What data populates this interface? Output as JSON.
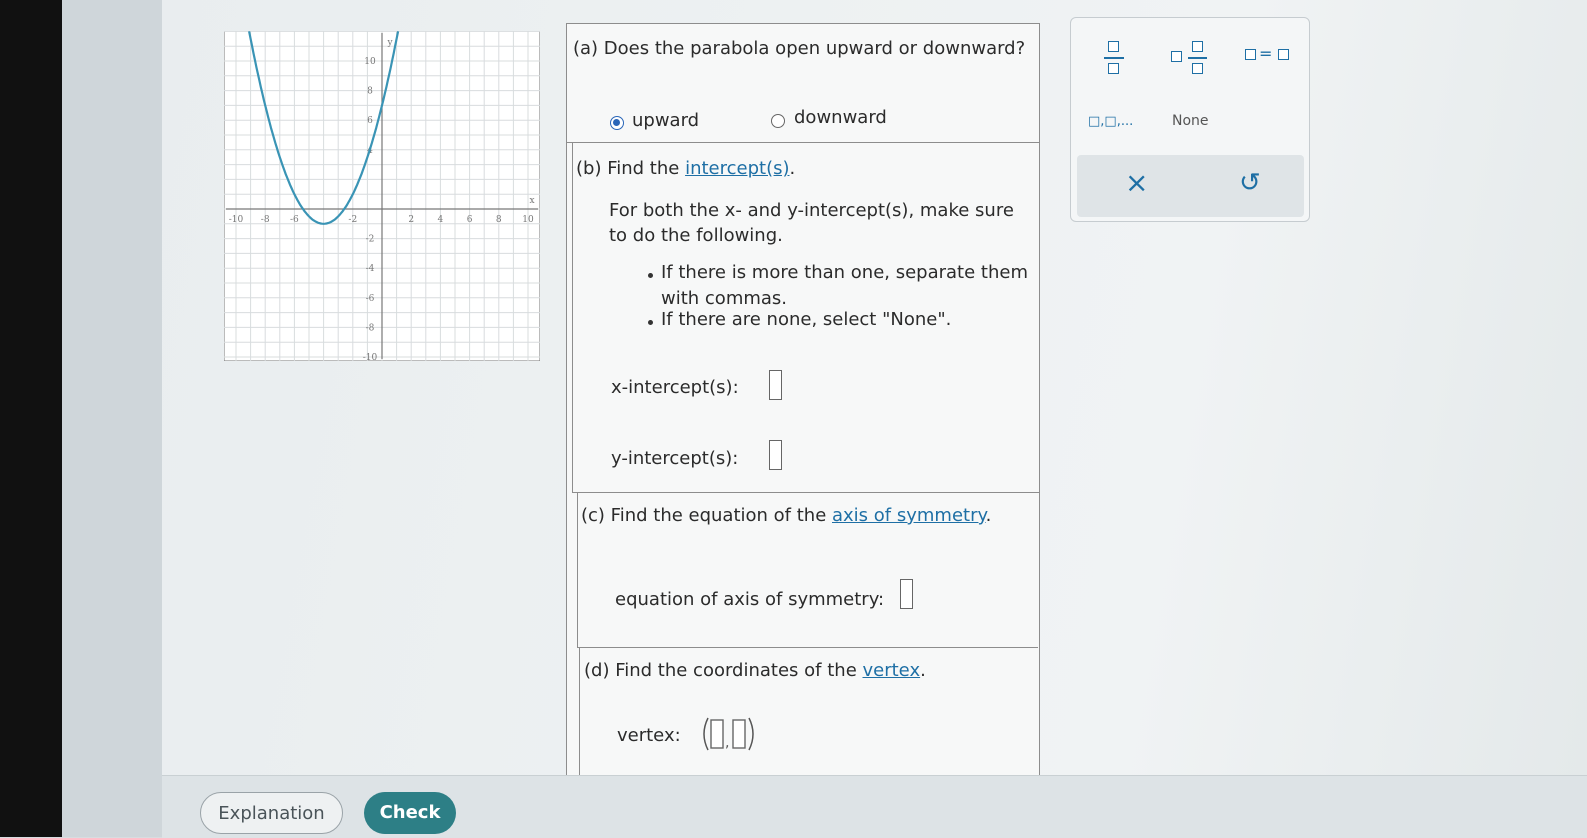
{
  "colors": {
    "accent": "#1e6fa5",
    "check_button": "#2d7f86",
    "curve": "#3a94b5",
    "radio_selected": "#2a66b8"
  },
  "graph": {
    "x_ticks": [
      "-10",
      "-8",
      "-6",
      "-2",
      "2",
      "4",
      "6",
      "8",
      "10"
    ],
    "y_ticks": [
      "10",
      "8",
      "6",
      "4",
      "-2",
      "-4",
      "-6",
      "-8",
      "-10"
    ],
    "y_axis_label": "y",
    "x_axis_label": "x"
  },
  "part_a": {
    "question": "(a) Does the parabola open upward or downward?",
    "options": [
      "upward",
      "downward"
    ],
    "selected": "upward"
  },
  "part_b": {
    "prefix": "(b) Find the ",
    "link": "intercept(s)",
    "suffix": ".",
    "instruction_line1": "For both the x- and y-intercept(s), make sure",
    "instruction_line2": "to do the following.",
    "bullet1_line1": "If there is more than one, separate them",
    "bullet1_line2": "with commas.",
    "bullet2": "If there are none, select \"None\".",
    "x_label": "x-intercept(s):",
    "y_label": "y-intercept(s):"
  },
  "part_c": {
    "prefix": "(c) Find the equation of the ",
    "link": "axis of symmetry",
    "suffix": ".",
    "answer_label": "equation of axis of symmetry:"
  },
  "part_d": {
    "prefix": "(d) Find the coordinates of the ",
    "link": "vertex",
    "suffix": ".",
    "answer_label": "vertex:"
  },
  "toolbox": {
    "list_label": "□,□,...",
    "none_label": "None",
    "clear_icon": "×",
    "undo_icon": "↺"
  },
  "buttons": {
    "explanation": "Explanation",
    "check": "Check"
  }
}
